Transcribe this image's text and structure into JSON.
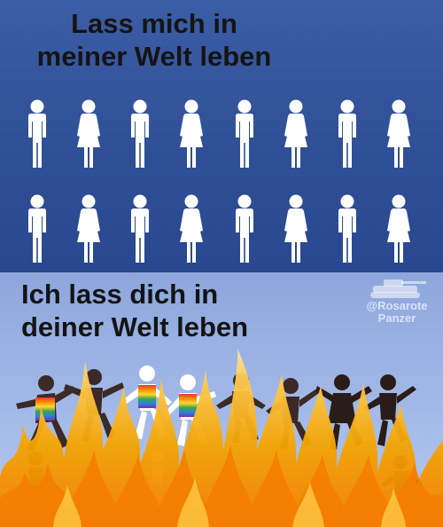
{
  "top_panel": {
    "caption_line1": "Lass mich in",
    "caption_line2": "meiner Welt leben",
    "rows": [
      [
        "man-icon",
        "woman-icon",
        "man-icon",
        "woman-icon",
        "man-icon",
        "woman-icon",
        "man-icon",
        "woman-icon"
      ],
      [
        "man-icon",
        "woman-icon",
        "man-icon",
        "woman-icon",
        "man-icon",
        "woman-icon",
        "man-icon",
        "woman-icon"
      ]
    ],
    "background_color": "#2f4f96",
    "figure_color": "#ffffff"
  },
  "bottom_panel": {
    "caption_line1": "Ich lass dich in",
    "caption_line2": "deiner Welt leben",
    "background_color": "#9fb6e6",
    "fire_colors": [
      "#f4b400",
      "#f57c00",
      "#ffd54f"
    ]
  },
  "watermark": {
    "handle": "@Rosarote",
    "word": "Panzer",
    "icon": "tank-icon"
  }
}
